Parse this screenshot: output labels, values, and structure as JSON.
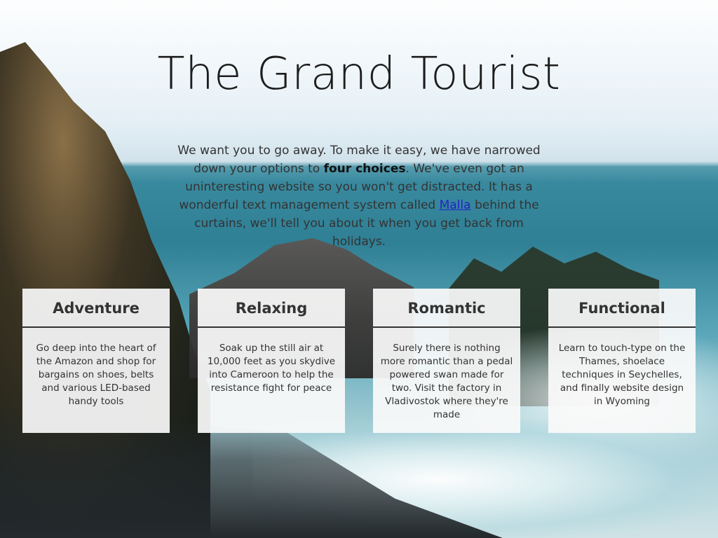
{
  "header": {
    "title": "The Grand Tourist"
  },
  "intro": {
    "part1": "We want you to go away. To make it easy, we have narrowed down your options to ",
    "bold": "four choices",
    "part2": ". We've even got an uninteresting website so you won't get distracted. It has a wonderful text management system called ",
    "link_text": "Malla",
    "part3": " behind the curtains, we'll tell you about it when you get back from holidays."
  },
  "cards": [
    {
      "title": "Adventure",
      "text": "Go deep into the heart of the Amazon and shop for bargains on shoes, belts and various LED-based handy tools"
    },
    {
      "title": "Relaxing",
      "text": "Soak up the still air at 10,000 feet as you skydive into Cameroon to help the resistance fight for peace"
    },
    {
      "title": "Romantic",
      "text": "Surely there is nothing more romantic than a pedal powered swan made for two. Visit the factory in Vladivostok where they're made"
    },
    {
      "title": "Functional",
      "text": "Learn to touch-type on the Thames, shoelace techniques in Seychelles, and finally website design in Wyoming"
    }
  ],
  "colors": {
    "link": "#2222cc",
    "text": "#333333",
    "card_bg": "#f0f0f0"
  }
}
